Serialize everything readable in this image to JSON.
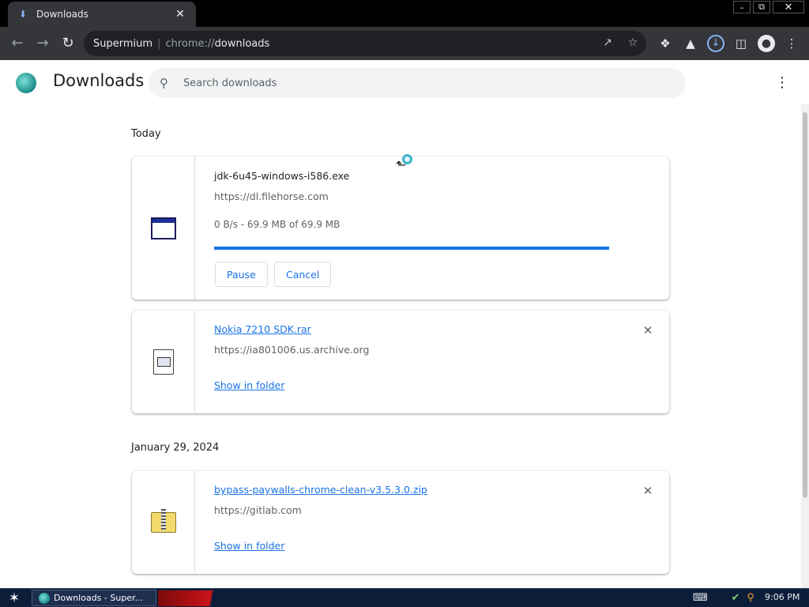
{
  "window": {
    "tab_title": "Downloads",
    "tab_icon": "download-icon",
    "controls": {
      "minimize": "–",
      "maximize": "⧉",
      "close": "✕"
    }
  },
  "toolbar": {
    "omnibox_host": "Supermium",
    "omnibox_url_scheme": "chrome://",
    "omnibox_url_path": "downloads"
  },
  "header": {
    "title": "Downloads",
    "search_placeholder": "Search downloads"
  },
  "groups": [
    {
      "date": "Today",
      "items": [
        {
          "file_name": "jdk-6u45-windows-i586.exe",
          "url": "https://dl.filehorse.com",
          "status": "0 B/s - 69.9 MB of 69.9 MB",
          "progress_fraction": 1.0,
          "pause_label": "Pause",
          "cancel_label": "Cancel"
        },
        {
          "file_name": "Nokia 7210 SDK.rar",
          "url": "https://ia801006.us.archive.org",
          "show_in_folder_label": "Show in folder"
        }
      ]
    },
    {
      "date": "January 29, 2024",
      "items": [
        {
          "file_name": "bypass-paywalls-chrome-clean-v3.5.3.0.zip",
          "url": "https://gitlab.com",
          "show_in_folder_label": "Show in folder"
        }
      ]
    }
  ],
  "taskbar": {
    "task_label": "Downloads - Super...",
    "clock": "9:06 PM"
  },
  "colors": {
    "accent": "#1a73e8",
    "toolbar_bg": "#35363a",
    "taskbar_bg": "#0c1d3a"
  }
}
